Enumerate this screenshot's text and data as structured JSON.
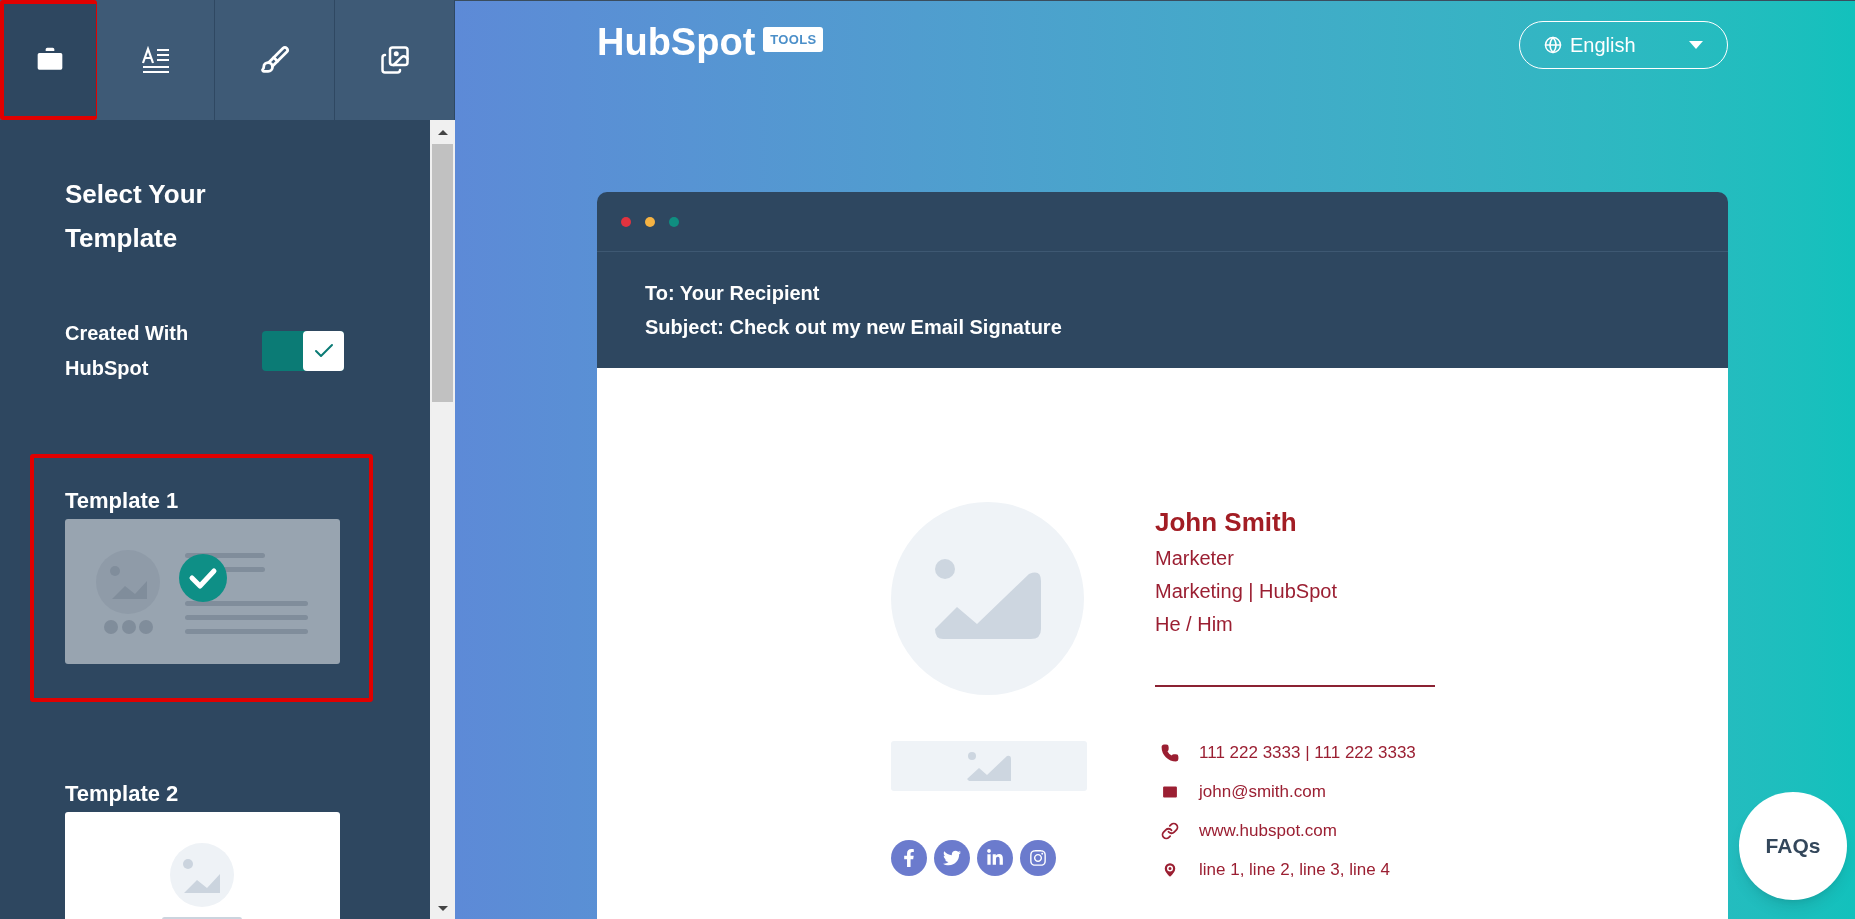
{
  "tabs": [
    {
      "kind": "templates",
      "selected": true
    },
    {
      "kind": "details",
      "selected": false
    },
    {
      "kind": "styling",
      "selected": false
    },
    {
      "kind": "images",
      "selected": false
    }
  ],
  "sidebar": {
    "title": "Select Your Template",
    "toggle": {
      "label": "Created With HubSpot",
      "on": true
    },
    "templates": [
      {
        "title": "Template 1",
        "kind": "side",
        "selected": true
      },
      {
        "title": "Template 2",
        "kind": "stacked",
        "selected": false
      }
    ]
  },
  "header": {
    "logo": "HubSpot",
    "badge": "TOOLS",
    "language": "English"
  },
  "email": {
    "to": "To: Your Recipient",
    "subject": "Subject: Check out my new Email Signature"
  },
  "signature": {
    "name": "John Smith",
    "lines": [
      "Marketer",
      "Marketing | HubSpot",
      "He / Him"
    ],
    "contacts": [
      {
        "kind": "phone",
        "text": "111 222 3333 | 111 222 3333"
      },
      {
        "kind": "email",
        "text": "john@smith.com"
      },
      {
        "kind": "website",
        "text": "www.hubspot.com"
      },
      {
        "kind": "address",
        "text": "line 1, line 2, line 3, line 4"
      }
    ],
    "social": [
      {
        "kind": "facebook"
      },
      {
        "kind": "twitter"
      },
      {
        "kind": "linkedin"
      },
      {
        "kind": "instagram"
      }
    ]
  },
  "faq": "FAQs"
}
